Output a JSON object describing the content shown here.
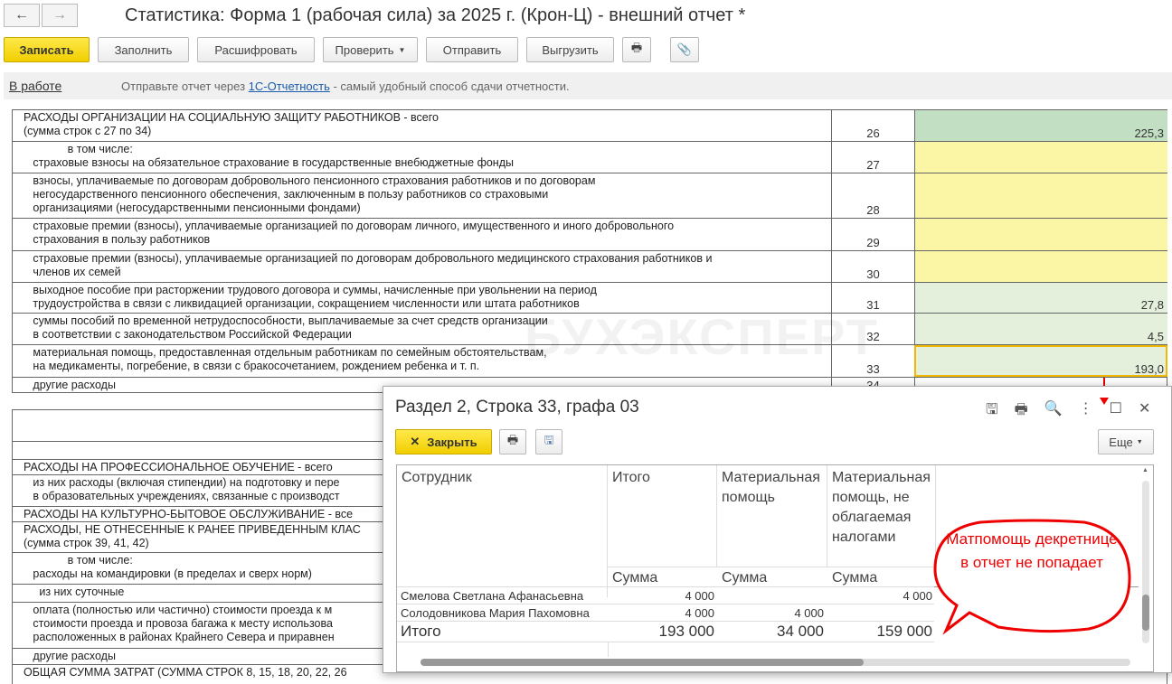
{
  "window": {
    "title": "Статистика: Форма 1 (рабочая сила) за 2025 г. (Крон-Ц) - внешний отчет *"
  },
  "nav": {
    "back": "←",
    "forward": "→"
  },
  "toolbar": {
    "save": "Записать",
    "fill": "Заполнить",
    "decode": "Расшифровать",
    "check": "Проверить",
    "send": "Отправить",
    "export": "Выгрузить"
  },
  "infobar": {
    "status": "В работе",
    "text_before": "Отправьте отчет через ",
    "link": "1С-Отчетность",
    "text_after": " - самый удобный способ сдачи отчетности."
  },
  "watermark": "БУХЭКСПЕРТ",
  "rows": [
    {
      "text": "РАСХОДЫ ОРГАНИЗАЦИИ НА СОЦИАЛЬНУЮ ЗАЩИТУ РАБОТНИКОВ - всего\n(сумма строк с 27 по 34)",
      "code": "26",
      "value": "225,3"
    },
    {
      "text": "              в том числе:\n   страховые взносы на обязательное страхование в государственные внебюджетные фонды",
      "code": "27",
      "value": ""
    },
    {
      "text": "   взносы, уплачиваемые по договорам добровольного пенсионного страхования работников и по договорам\n   негосударственного пенсионного обеспечения, заключенным в пользу работников со страховыми\n   организациями (негосударственными пенсионными фондами)",
      "code": "28",
      "value": ""
    },
    {
      "text": "   страховые премии (взносы), уплачиваемые организацией по договорам личного, имущественного и иного добровольного\n   страхования в пользу работников",
      "code": "29",
      "value": ""
    },
    {
      "text": "   страховые премии (взносы), уплачиваемые организацией по договорам добровольного медицинского страхования работников и\n   членов их семей",
      "code": "30",
      "value": ""
    },
    {
      "text": "   выходное пособие при расторжении трудового договора и суммы, начисленные при увольнении на период\n   трудоустройства в связи с ликвидацией организации, сокращением численности или штата работников",
      "code": "31",
      "value": "27,8"
    },
    {
      "text": "   суммы пособий по временной нетрудоспособности, выплачиваемые за счет средств организации\n   в соответствии с законодательством Российской Федерации",
      "code": "32",
      "value": "4,5"
    },
    {
      "text": "   материальная помощь, предоставленная отдельным работникам по семейным обстоятельствам,\n   на медикаменты, погребение, в связи с бракосочетанием, рождением ребенка и т. п.",
      "code": "33",
      "value": "193,0"
    },
    {
      "text": "   другие расходы",
      "code": "34",
      "value": ""
    }
  ],
  "rows2": [
    "РАСХОДЫ НА ПРОФЕССИОНАЛЬНОЕ ОБУЧЕНИЕ - всего",
    "   из них расходы (включая стипендии) на подготовку и пере\n   в образовательных учреждениях, связанные с производст",
    "РАСХОДЫ НА КУЛЬТУРНО-БЫТОВОЕ ОБСЛУЖИВАНИЕ - все",
    "РАСХОДЫ, НЕ ОТНЕСЕННЫЕ К РАНЕЕ ПРИВЕДЕННЫМ КЛАС\n(сумма строк 39, 41, 42)",
    "              в том числе:\n   расходы на командировки (в пределах и сверх норм)",
    "     из них суточные",
    "   оплата (полностью или частично) стоимости проезда к м\n   стоимости проезда и провоза багажа к месту использова\n   расположенных в районах Крайнего Севера и приравнен",
    "   другие расходы",
    "ОБЩАЯ СУММА ЗАТРАТ (СУММА СТРОК 8, 15, 18, 20, 22, 26"
  ],
  "popup": {
    "title": "Раздел 2, Строка 33, графа 03",
    "close": "Закрыть",
    "more": "Еще",
    "headers": [
      "Сотрудник",
      "Итого",
      "Материальная помощь",
      "Материальная помощь, не облагаемая налогами"
    ],
    "sub": "Сумма",
    "rows": [
      {
        "name": "Смелова Светлана Афанасьевна",
        "total": "4 000",
        "mat": "",
        "mat_free": "4 000"
      },
      {
        "name": "Солодовникова Мария Пахомовна",
        "total": "4 000",
        "mat": "4 000",
        "mat_free": ""
      }
    ],
    "totals": {
      "label": "Итого",
      "total": "193 000",
      "mat": "34 000",
      "mat_free": "159 000"
    }
  },
  "callout": "Матпомощь декретнице в отчет не попадает"
}
